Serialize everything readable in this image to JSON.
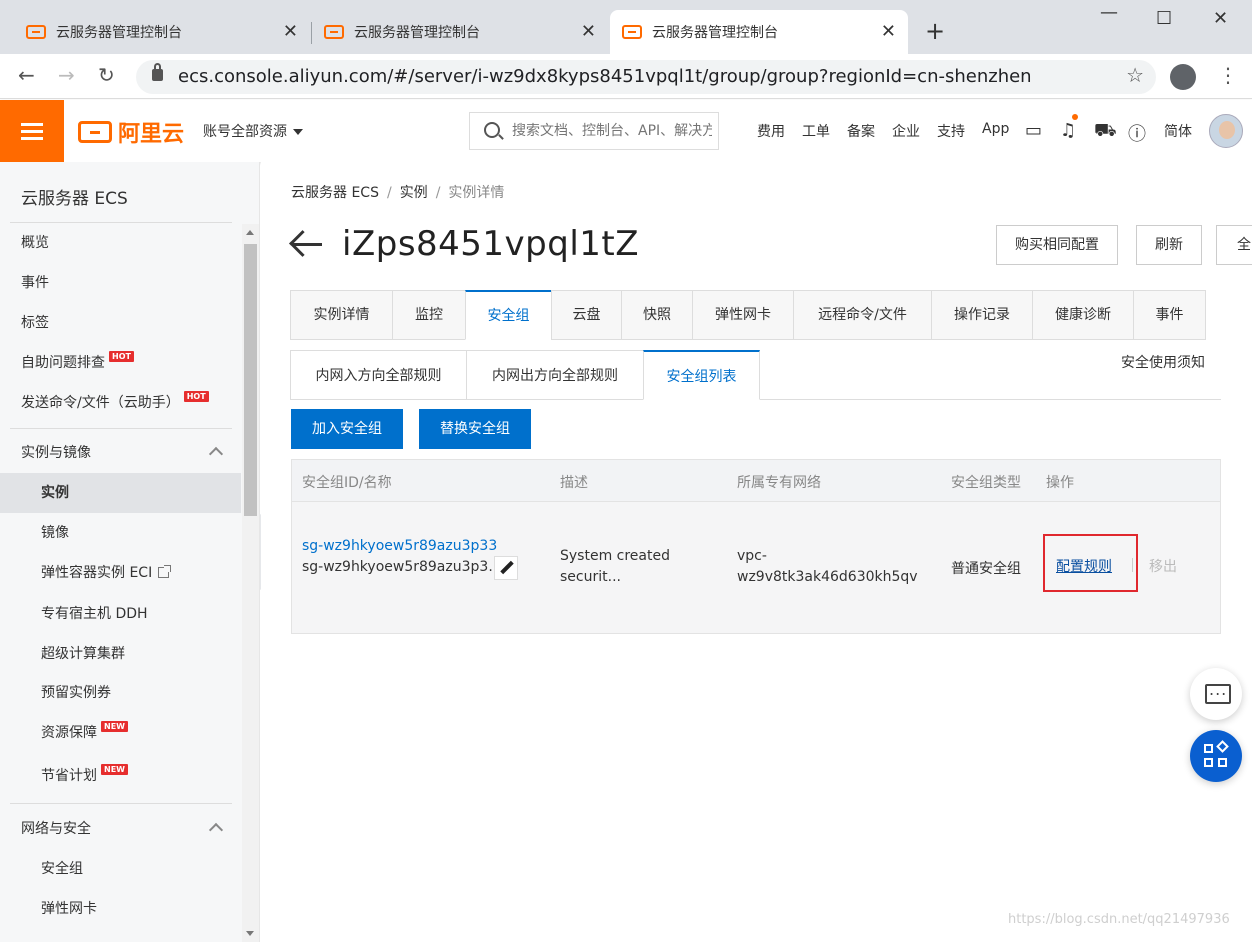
{
  "browser": {
    "tabs": [
      {
        "title": "云服务器管理控制台"
      },
      {
        "title": "云服务器管理控制台"
      },
      {
        "title": "云服务器管理控制台"
      }
    ],
    "url": "ecs.console.aliyun.com/#/server/i-wz9dx8kyps8451vpql1t/group/group?regionId=cn-shenzhen"
  },
  "topbar": {
    "logo_text": "阿里云",
    "account_label": "账号全部资源",
    "search_placeholder": "搜索文档、控制台、API、解决方案和资源",
    "nav": [
      "费用",
      "工单",
      "备案",
      "企业",
      "支持",
      "App"
    ],
    "lang": "简体"
  },
  "sidebar": {
    "title": "云服务器 ECS",
    "items": [
      {
        "label": "概览"
      },
      {
        "label": "事件"
      },
      {
        "label": "标签"
      },
      {
        "label": "自助问题排查",
        "badge": "HOT"
      },
      {
        "label": "发送命令/文件（云助手）",
        "badge": "HOT"
      }
    ],
    "group1": {
      "label": "实例与镜像",
      "items": [
        {
          "label": "实例"
        },
        {
          "label": "镜像"
        },
        {
          "label": "弹性容器实例 ECI"
        },
        {
          "label": "专有宿主机 DDH"
        },
        {
          "label": "超级计算集群"
        },
        {
          "label": "预留实例券"
        },
        {
          "label": "资源保障",
          "badge": "NEW"
        },
        {
          "label": "节省计划",
          "badge": "NEW"
        }
      ]
    },
    "group2": {
      "label": "网络与安全",
      "items": [
        {
          "label": "安全组"
        },
        {
          "label": "弹性网卡"
        }
      ]
    }
  },
  "main": {
    "breadcrumb": [
      "云服务器 ECS",
      "实例",
      "实例详情"
    ],
    "instance_title": "iZps8451vpql1tZ",
    "header_buttons": [
      "购买相同配置",
      "刷新",
      "全"
    ],
    "tabs": [
      "实例详情",
      "监控",
      "安全组",
      "云盘",
      "快照",
      "弹性网卡",
      "远程命令/文件",
      "操作记录",
      "健康诊断",
      "事件"
    ],
    "subtabs": [
      "内网入方向全部规则",
      "内网出方向全部规则",
      "安全组列表"
    ],
    "notice": "安全使用须知",
    "actions": [
      "加入安全组",
      "替换安全组"
    ],
    "table": {
      "headers": [
        "安全组ID/名称",
        "描述",
        "所属专有网络",
        "安全组类型",
        "操作"
      ],
      "row": {
        "sg_id": "sg-wz9hkyoew5r89azu3p33",
        "sg_name": "sg-wz9hkyoew5r89azu3p3...",
        "desc_line1": "System created",
        "desc_line2": "securit...",
        "vpc_line1": "vpc-",
        "vpc_line2": "wz9v8tk3ak46d630kh5qv",
        "type": "普通安全组",
        "op_configure": "配置规则",
        "op_remove": "移出"
      }
    }
  },
  "watermark": "https://blog.csdn.net/qq21497936"
}
